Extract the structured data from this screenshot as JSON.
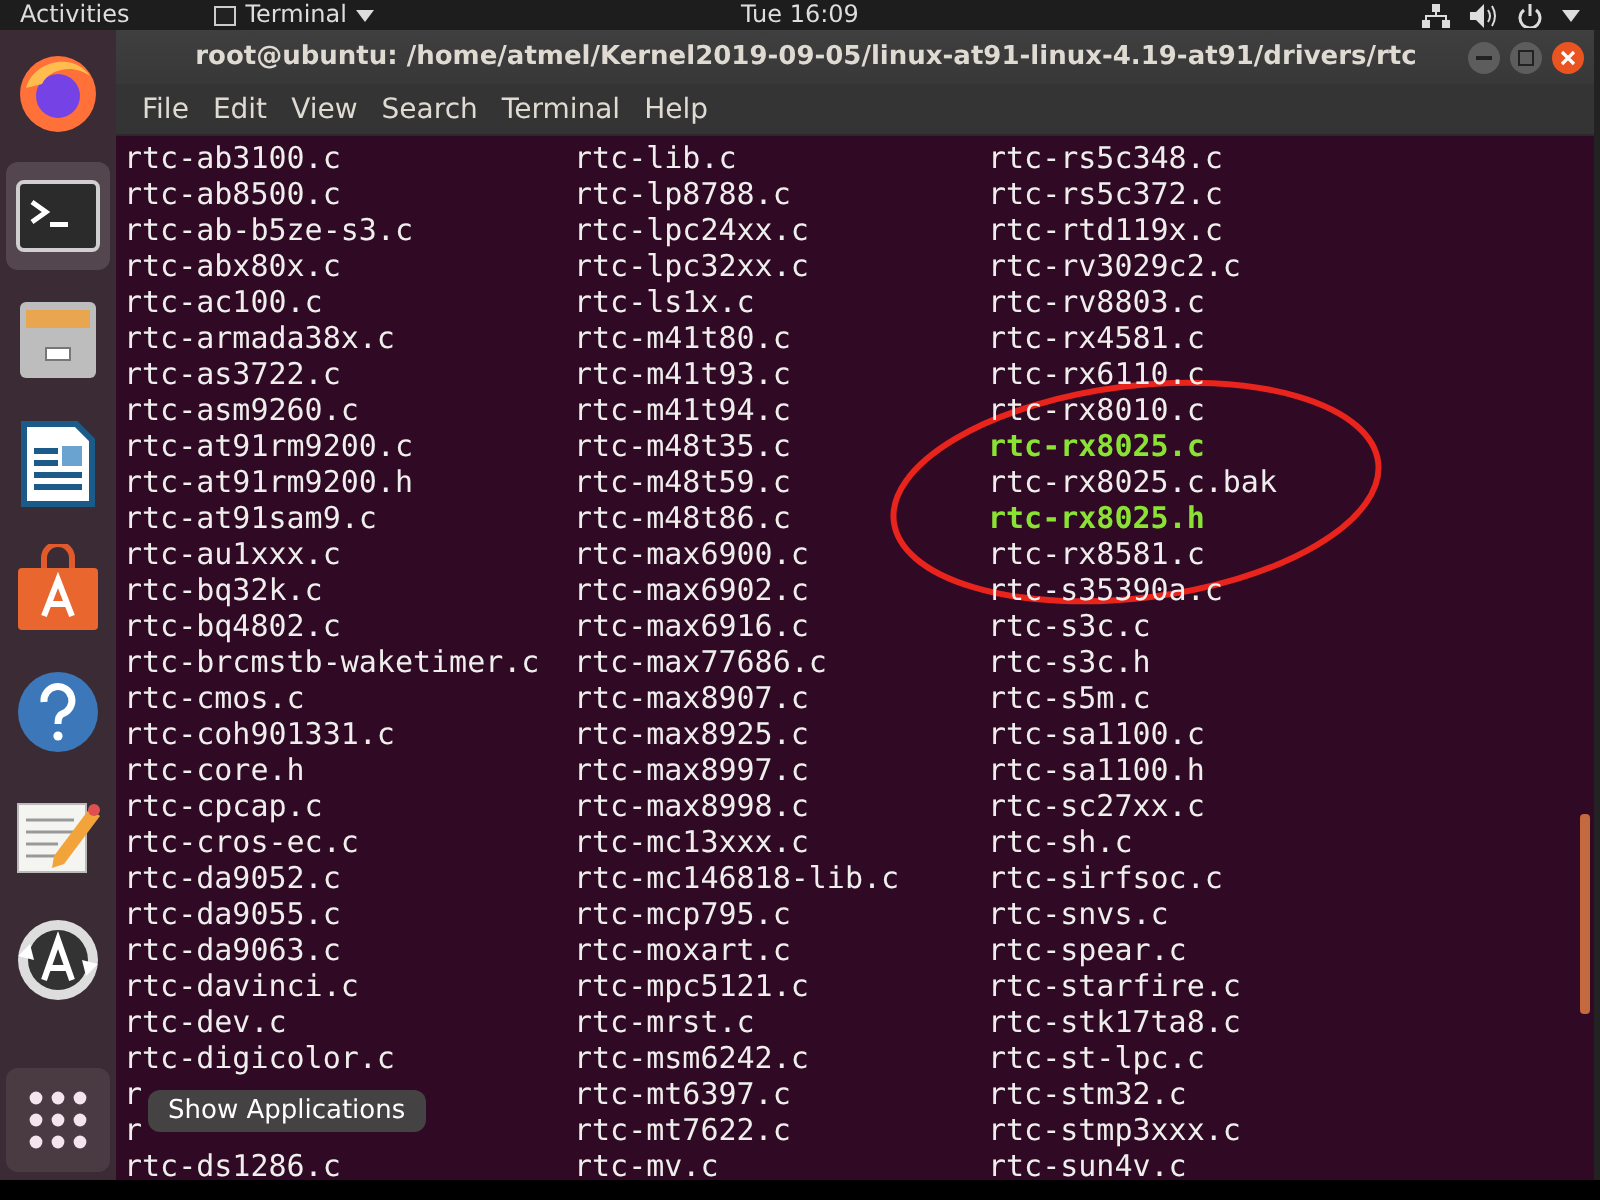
{
  "top_bar": {
    "activities": "Activities",
    "app_menu": "Terminal",
    "clock": "Tue 16:09"
  },
  "dock": {
    "items": [
      {
        "kind": "browser",
        "selected": false
      },
      {
        "kind": "terminal",
        "selected": true
      },
      {
        "kind": "files",
        "selected": false
      },
      {
        "kind": "writer",
        "selected": false
      },
      {
        "kind": "software",
        "selected": false
      },
      {
        "kind": "help",
        "selected": false
      },
      {
        "kind": "editor",
        "selected": false
      },
      {
        "kind": "updater",
        "selected": false
      }
    ],
    "tooltip": "Show Applications"
  },
  "window": {
    "title": "root@ubuntu: /home/atmel/Kernel2019-09-05/linux-at91-linux-4.19-at91/drivers/rtc"
  },
  "menu": [
    "File",
    "Edit",
    "View",
    "Search",
    "Terminal",
    "Help"
  ],
  "listing": {
    "columns": [
      {
        "files": [
          {
            "name": "rtc-ab3100.c",
            "highlighted": false
          },
          {
            "name": "rtc-ab8500.c",
            "highlighted": false
          },
          {
            "name": "rtc-ab-b5ze-s3.c",
            "highlighted": false
          },
          {
            "name": "rtc-abx80x.c",
            "highlighted": false
          },
          {
            "name": "rtc-ac100.c",
            "highlighted": false
          },
          {
            "name": "rtc-armada38x.c",
            "highlighted": false
          },
          {
            "name": "rtc-as3722.c",
            "highlighted": false
          },
          {
            "name": "rtc-asm9260.c",
            "highlighted": false
          },
          {
            "name": "rtc-at91rm9200.c",
            "highlighted": false
          },
          {
            "name": "rtc-at91rm9200.h",
            "highlighted": false
          },
          {
            "name": "rtc-at91sam9.c",
            "highlighted": false
          },
          {
            "name": "rtc-au1xxx.c",
            "highlighted": false
          },
          {
            "name": "rtc-bq32k.c",
            "highlighted": false
          },
          {
            "name": "rtc-bq4802.c",
            "highlighted": false
          },
          {
            "name": "rtc-brcmstb-waketimer.c",
            "highlighted": false
          },
          {
            "name": "rtc-cmos.c",
            "highlighted": false
          },
          {
            "name": "rtc-coh901331.c",
            "highlighted": false
          },
          {
            "name": "rtc-core.h",
            "highlighted": false
          },
          {
            "name": "rtc-cpcap.c",
            "highlighted": false
          },
          {
            "name": "rtc-cros-ec.c",
            "highlighted": false
          },
          {
            "name": "rtc-da9052.c",
            "highlighted": false
          },
          {
            "name": "rtc-da9055.c",
            "highlighted": false
          },
          {
            "name": "rtc-da9063.c",
            "highlighted": false
          },
          {
            "name": "rtc-davinci.c",
            "highlighted": false
          },
          {
            "name": "rtc-dev.c",
            "highlighted": false
          },
          {
            "name": "rtc-digicolor.c",
            "highlighted": false
          },
          {
            "name": "r",
            "highlighted": false
          },
          {
            "name": "r",
            "highlighted": false
          },
          {
            "name": "rtc-ds1286.c",
            "highlighted": false
          }
        ]
      },
      {
        "files": [
          {
            "name": "rtc-lib.c",
            "highlighted": false
          },
          {
            "name": "rtc-lp8788.c",
            "highlighted": false
          },
          {
            "name": "rtc-lpc24xx.c",
            "highlighted": false
          },
          {
            "name": "rtc-lpc32xx.c",
            "highlighted": false
          },
          {
            "name": "rtc-ls1x.c",
            "highlighted": false
          },
          {
            "name": "rtc-m41t80.c",
            "highlighted": false
          },
          {
            "name": "rtc-m41t93.c",
            "highlighted": false
          },
          {
            "name": "rtc-m41t94.c",
            "highlighted": false
          },
          {
            "name": "rtc-m48t35.c",
            "highlighted": false
          },
          {
            "name": "rtc-m48t59.c",
            "highlighted": false
          },
          {
            "name": "rtc-m48t86.c",
            "highlighted": false
          },
          {
            "name": "rtc-max6900.c",
            "highlighted": false
          },
          {
            "name": "rtc-max6902.c",
            "highlighted": false
          },
          {
            "name": "rtc-max6916.c",
            "highlighted": false
          },
          {
            "name": "rtc-max77686.c",
            "highlighted": false
          },
          {
            "name": "rtc-max8907.c",
            "highlighted": false
          },
          {
            "name": "rtc-max8925.c",
            "highlighted": false
          },
          {
            "name": "rtc-max8997.c",
            "highlighted": false
          },
          {
            "name": "rtc-max8998.c",
            "highlighted": false
          },
          {
            "name": "rtc-mc13xxx.c",
            "highlighted": false
          },
          {
            "name": "rtc-mc146818-lib.c",
            "highlighted": false
          },
          {
            "name": "rtc-mcp795.c",
            "highlighted": false
          },
          {
            "name": "rtc-moxart.c",
            "highlighted": false
          },
          {
            "name": "rtc-mpc5121.c",
            "highlighted": false
          },
          {
            "name": "rtc-mrst.c",
            "highlighted": false
          },
          {
            "name": "rtc-msm6242.c",
            "highlighted": false
          },
          {
            "name": "rtc-mt6397.c",
            "highlighted": false
          },
          {
            "name": "rtc-mt7622.c",
            "highlighted": false
          },
          {
            "name": "rtc-mv.c",
            "highlighted": false
          }
        ]
      },
      {
        "files": [
          {
            "name": "rtc-rs5c348.c",
            "highlighted": false
          },
          {
            "name": "rtc-rs5c372.c",
            "highlighted": false
          },
          {
            "name": "rtc-rtd119x.c",
            "highlighted": false
          },
          {
            "name": "rtc-rv3029c2.c",
            "highlighted": false
          },
          {
            "name": "rtc-rv8803.c",
            "highlighted": false
          },
          {
            "name": "rtc-rx4581.c",
            "highlighted": false
          },
          {
            "name": "rtc-rx6110.c",
            "highlighted": false
          },
          {
            "name": "rtc-rx8010.c",
            "highlighted": false
          },
          {
            "name": "rtc-rx8025.c",
            "highlighted": true
          },
          {
            "name": "rtc-rx8025.c.bak",
            "highlighted": false
          },
          {
            "name": "rtc-rx8025.h",
            "highlighted": true
          },
          {
            "name": "rtc-rx8581.c",
            "highlighted": false
          },
          {
            "name": "rtc-s35390a.c",
            "highlighted": false
          },
          {
            "name": "rtc-s3c.c",
            "highlighted": false
          },
          {
            "name": "rtc-s3c.h",
            "highlighted": false
          },
          {
            "name": "rtc-s5m.c",
            "highlighted": false
          },
          {
            "name": "rtc-sa1100.c",
            "highlighted": false
          },
          {
            "name": "rtc-sa1100.h",
            "highlighted": false
          },
          {
            "name": "rtc-sc27xx.c",
            "highlighted": false
          },
          {
            "name": "rtc-sh.c",
            "highlighted": false
          },
          {
            "name": "rtc-sirfsoc.c",
            "highlighted": false
          },
          {
            "name": "rtc-snvs.c",
            "highlighted": false
          },
          {
            "name": "rtc-spear.c",
            "highlighted": false
          },
          {
            "name": "rtc-starfire.c",
            "highlighted": false
          },
          {
            "name": "rtc-stk17ta8.c",
            "highlighted": false
          },
          {
            "name": "rtc-st-lpc.c",
            "highlighted": false
          },
          {
            "name": "rtc-stm32.c",
            "highlighted": false
          },
          {
            "name": "rtc-stmp3xxx.c",
            "highlighted": false
          },
          {
            "name": "rtc-sun4v.c",
            "highlighted": false
          }
        ]
      }
    ]
  }
}
